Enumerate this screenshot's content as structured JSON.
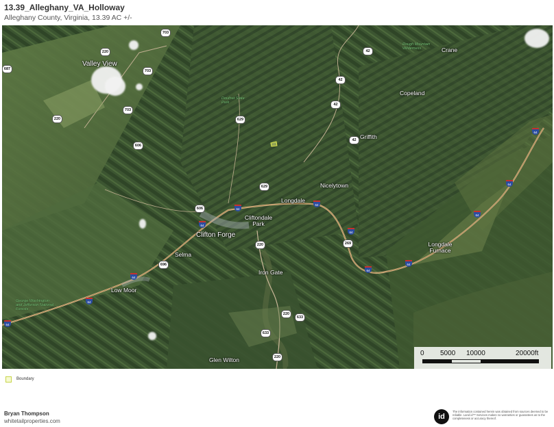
{
  "header": {
    "title": "13.39_Alleghany_VA_Holloway",
    "subtitle": "Alleghany County, Virginia, 13.39 AC +/-"
  },
  "map": {
    "places": {
      "valley_view": "Valley View",
      "crane": "Crane",
      "copeland": "Copeland",
      "griffith": "Griffith",
      "nicelytown": "Nicelytown",
      "longdale": "Longdale",
      "cliftondale_park": "Cliftondale Park",
      "clifton_forge": "Clifton Forge",
      "selma": "Selma",
      "iron_gate": "Iron Gate",
      "low_moor": "Low Moor",
      "longdale_furnace": "Longdale Furnace",
      "glen_wilton": "Glen Wilton"
    },
    "parks": {
      "rough_mountain": "Rough Mountain Wilderness",
      "douthat": "Douthat State Park",
      "gw_forest": "George Washington and Jefferson National Forests"
    },
    "shields": {
      "r703a": "703",
      "r220a": "220",
      "r687": "687",
      "r703b": "703",
      "r703c": "703",
      "r220b": "220",
      "r606": "606",
      "r42a": "42",
      "r42b": "42",
      "r42c": "42",
      "r42d": "42",
      "r629a": "629",
      "r629b": "629",
      "r606b": "606",
      "r220c": "220",
      "r269": "269",
      "r696": "696",
      "r220d": "220",
      "r633a": "633",
      "r633b": "633",
      "r220e": "220"
    },
    "interstates": {
      "i1": "64",
      "i2": "64",
      "i3": "64",
      "i4": "64",
      "i5": "64",
      "i6": "64",
      "i7": "64",
      "i8": "64",
      "i9": "64",
      "i10": "64",
      "i11": "64",
      "i12": "64"
    },
    "scale": {
      "t0": "0",
      "t1": "5000",
      "t2": "10000",
      "t3": "20000ft"
    }
  },
  "legend": {
    "boundary_label": "Boundary",
    "boundary_color": "#c7d44a"
  },
  "footer": {
    "author": "Bryan Thompson",
    "website": "whitetailproperties.com",
    "logo_text": "id",
    "disclaimer": "The information contained herein was obtained from sources deemed to be reliable. Land id™ Services makes no warranties or guarantees as to the completeness or accuracy thereof."
  }
}
